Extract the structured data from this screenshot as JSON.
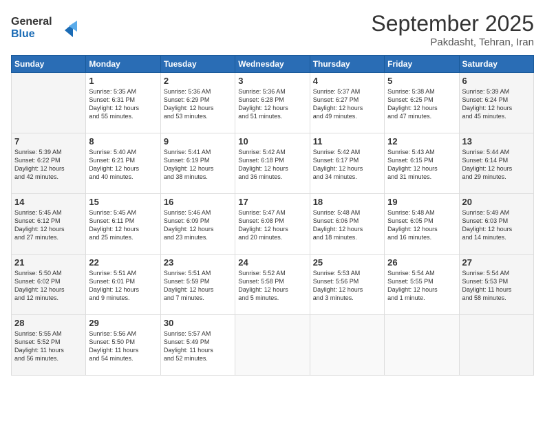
{
  "header": {
    "logo_line1": "General",
    "logo_line2": "Blue",
    "month": "September 2025",
    "location": "Pakdasht, Tehran, Iran"
  },
  "weekdays": [
    "Sunday",
    "Monday",
    "Tuesday",
    "Wednesday",
    "Thursday",
    "Friday",
    "Saturday"
  ],
  "weeks": [
    [
      {
        "day": "",
        "text": ""
      },
      {
        "day": "1",
        "text": "Sunrise: 5:35 AM\nSunset: 6:31 PM\nDaylight: 12 hours\nand 55 minutes."
      },
      {
        "day": "2",
        "text": "Sunrise: 5:36 AM\nSunset: 6:29 PM\nDaylight: 12 hours\nand 53 minutes."
      },
      {
        "day": "3",
        "text": "Sunrise: 5:36 AM\nSunset: 6:28 PM\nDaylight: 12 hours\nand 51 minutes."
      },
      {
        "day": "4",
        "text": "Sunrise: 5:37 AM\nSunset: 6:27 PM\nDaylight: 12 hours\nand 49 minutes."
      },
      {
        "day": "5",
        "text": "Sunrise: 5:38 AM\nSunset: 6:25 PM\nDaylight: 12 hours\nand 47 minutes."
      },
      {
        "day": "6",
        "text": "Sunrise: 5:39 AM\nSunset: 6:24 PM\nDaylight: 12 hours\nand 45 minutes."
      }
    ],
    [
      {
        "day": "7",
        "text": "Sunrise: 5:39 AM\nSunset: 6:22 PM\nDaylight: 12 hours\nand 42 minutes."
      },
      {
        "day": "8",
        "text": "Sunrise: 5:40 AM\nSunset: 6:21 PM\nDaylight: 12 hours\nand 40 minutes."
      },
      {
        "day": "9",
        "text": "Sunrise: 5:41 AM\nSunset: 6:19 PM\nDaylight: 12 hours\nand 38 minutes."
      },
      {
        "day": "10",
        "text": "Sunrise: 5:42 AM\nSunset: 6:18 PM\nDaylight: 12 hours\nand 36 minutes."
      },
      {
        "day": "11",
        "text": "Sunrise: 5:42 AM\nSunset: 6:17 PM\nDaylight: 12 hours\nand 34 minutes."
      },
      {
        "day": "12",
        "text": "Sunrise: 5:43 AM\nSunset: 6:15 PM\nDaylight: 12 hours\nand 31 minutes."
      },
      {
        "day": "13",
        "text": "Sunrise: 5:44 AM\nSunset: 6:14 PM\nDaylight: 12 hours\nand 29 minutes."
      }
    ],
    [
      {
        "day": "14",
        "text": "Sunrise: 5:45 AM\nSunset: 6:12 PM\nDaylight: 12 hours\nand 27 minutes."
      },
      {
        "day": "15",
        "text": "Sunrise: 5:45 AM\nSunset: 6:11 PM\nDaylight: 12 hours\nand 25 minutes."
      },
      {
        "day": "16",
        "text": "Sunrise: 5:46 AM\nSunset: 6:09 PM\nDaylight: 12 hours\nand 23 minutes."
      },
      {
        "day": "17",
        "text": "Sunrise: 5:47 AM\nSunset: 6:08 PM\nDaylight: 12 hours\nand 20 minutes."
      },
      {
        "day": "18",
        "text": "Sunrise: 5:48 AM\nSunset: 6:06 PM\nDaylight: 12 hours\nand 18 minutes."
      },
      {
        "day": "19",
        "text": "Sunrise: 5:48 AM\nSunset: 6:05 PM\nDaylight: 12 hours\nand 16 minutes."
      },
      {
        "day": "20",
        "text": "Sunrise: 5:49 AM\nSunset: 6:03 PM\nDaylight: 12 hours\nand 14 minutes."
      }
    ],
    [
      {
        "day": "21",
        "text": "Sunrise: 5:50 AM\nSunset: 6:02 PM\nDaylight: 12 hours\nand 12 minutes."
      },
      {
        "day": "22",
        "text": "Sunrise: 5:51 AM\nSunset: 6:01 PM\nDaylight: 12 hours\nand 9 minutes."
      },
      {
        "day": "23",
        "text": "Sunrise: 5:51 AM\nSunset: 5:59 PM\nDaylight: 12 hours\nand 7 minutes."
      },
      {
        "day": "24",
        "text": "Sunrise: 5:52 AM\nSunset: 5:58 PM\nDaylight: 12 hours\nand 5 minutes."
      },
      {
        "day": "25",
        "text": "Sunrise: 5:53 AM\nSunset: 5:56 PM\nDaylight: 12 hours\nand 3 minutes."
      },
      {
        "day": "26",
        "text": "Sunrise: 5:54 AM\nSunset: 5:55 PM\nDaylight: 12 hours\nand 1 minute."
      },
      {
        "day": "27",
        "text": "Sunrise: 5:54 AM\nSunset: 5:53 PM\nDaylight: 11 hours\nand 58 minutes."
      }
    ],
    [
      {
        "day": "28",
        "text": "Sunrise: 5:55 AM\nSunset: 5:52 PM\nDaylight: 11 hours\nand 56 minutes."
      },
      {
        "day": "29",
        "text": "Sunrise: 5:56 AM\nSunset: 5:50 PM\nDaylight: 11 hours\nand 54 minutes."
      },
      {
        "day": "30",
        "text": "Sunrise: 5:57 AM\nSunset: 5:49 PM\nDaylight: 11 hours\nand 52 minutes."
      },
      {
        "day": "",
        "text": ""
      },
      {
        "day": "",
        "text": ""
      },
      {
        "day": "",
        "text": ""
      },
      {
        "day": "",
        "text": ""
      }
    ]
  ]
}
